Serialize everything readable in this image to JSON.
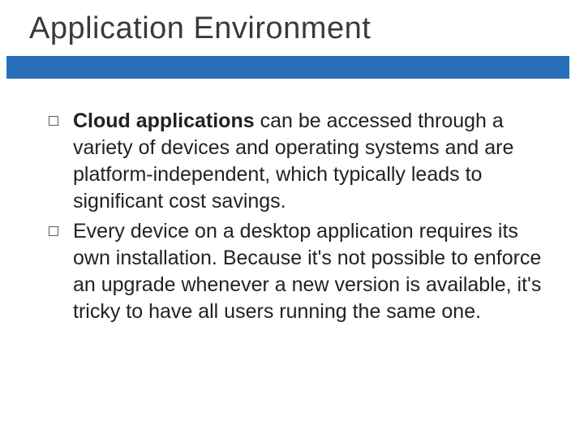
{
  "title": "Application Environment",
  "bullets": [
    {
      "bold_lead": "Cloud applications",
      "rest": " can be accessed through a variety of devices and operating systems and are platform-independent, which typically leads to significant cost savings."
    },
    {
      "bold_lead": "",
      "rest": "Every device on a desktop application requires its own installation. Because it's not possible to enforce an upgrade whenever a new version is available, it's tricky to have all users running the same one."
    }
  ]
}
